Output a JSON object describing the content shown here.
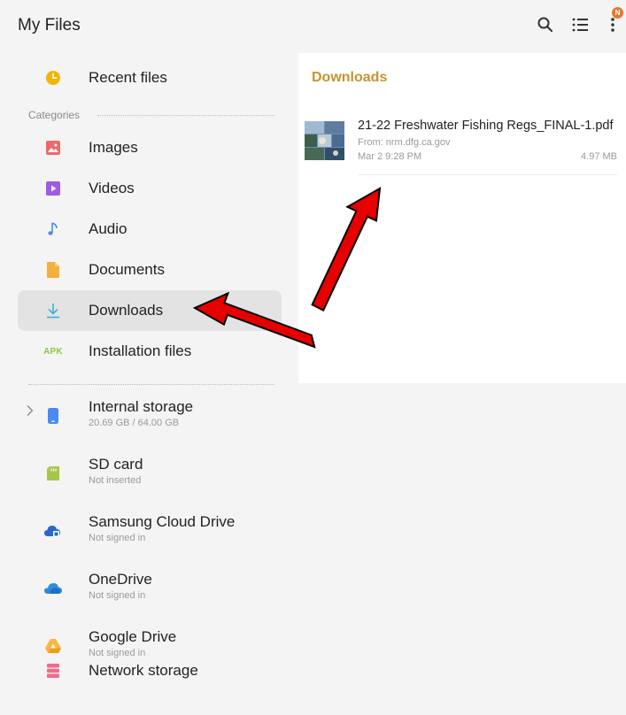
{
  "header": {
    "title": "My Files",
    "actions": [
      {
        "name": "search-icon"
      },
      {
        "name": "list-view-icon"
      },
      {
        "name": "more-options-icon",
        "badge": "N"
      }
    ]
  },
  "sidebar": {
    "recent": {
      "label": "Recent files",
      "icon": "clock-icon",
      "color": "#f2b500"
    },
    "categories_header": "Categories",
    "categories": [
      {
        "label": "Images",
        "icon": "image-icon",
        "color": "#ec6a6a"
      },
      {
        "label": "Videos",
        "icon": "video-icon",
        "color": "#9d5ce6"
      },
      {
        "label": "Audio",
        "icon": "music-note-icon",
        "color": "#4a8af0"
      },
      {
        "label": "Documents",
        "icon": "document-icon",
        "color": "#f3b03e"
      },
      {
        "label": "Downloads",
        "icon": "download-icon",
        "color": "#3bb3d5",
        "selected": true
      },
      {
        "label": "Installation files",
        "icon": "apk-icon",
        "icon_text": "APK",
        "color": "#8dc63f"
      }
    ],
    "storage": [
      {
        "label": "Internal storage",
        "sub": "20.69 GB / 64.00 GB",
        "icon": "phone-icon",
        "color": "#4a8af0",
        "expandable": true
      },
      {
        "label": "SD card",
        "sub": "Not inserted",
        "icon": "sd-card-icon",
        "color": "#a6c64b"
      },
      {
        "label": "Samsung Cloud Drive",
        "sub": "Not signed in",
        "icon": "samsung-cloud-icon",
        "color": "#2b67c9"
      },
      {
        "label": "OneDrive",
        "sub": "Not signed in",
        "icon": "onedrive-icon",
        "color": "#2f8be0"
      },
      {
        "label": "Google Drive",
        "sub": "Not signed in",
        "icon": "google-drive-icon",
        "color": "#f6b93b"
      },
      {
        "label": "Network storage",
        "icon": "network-storage-icon",
        "color": "#f26b8a"
      }
    ]
  },
  "main": {
    "breadcrumb": "Downloads",
    "files": [
      {
        "name": "21-22 Freshwater Fishing Regs_FINAL-1.pdf",
        "from": "From: nrm.dfg.ca.gov",
        "date": "Mar 2 9:28 PM",
        "size": "4.97 MB",
        "thumbnail": "pdf-thumbnail"
      }
    ]
  },
  "colors": {
    "background": "#f4f4f4",
    "panel": "#ffffff",
    "accent": "#c4942e",
    "selected": "#e3e3e3",
    "annotation_arrow": "#e00000"
  }
}
